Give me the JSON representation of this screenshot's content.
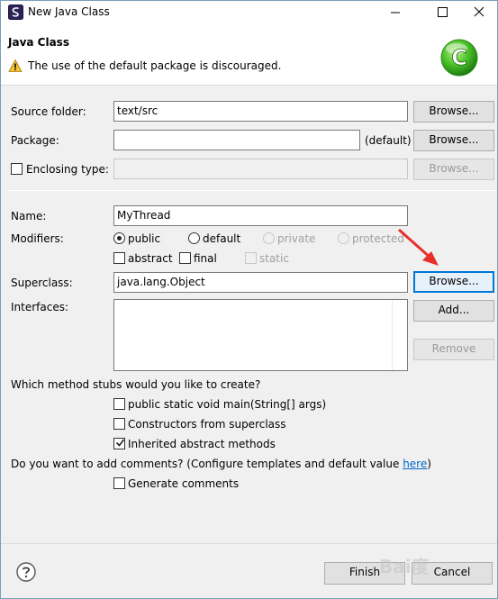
{
  "window": {
    "title": "New Java Class",
    "controls": {
      "minimize": "minimize-icon",
      "maximize": "maximize-icon",
      "close": "close-icon"
    }
  },
  "banner": {
    "title": "Java Class",
    "message": "The use of the default package is discouraged.",
    "logo_letter": "C"
  },
  "form": {
    "source_folder": {
      "label": "Source folder:",
      "value": "text/src",
      "button": "Browse..."
    },
    "package": {
      "label": "Package:",
      "value": "",
      "suffix": "(default)",
      "button": "Browse..."
    },
    "enclosing_type": {
      "label": "Enclosing type:",
      "checked": false,
      "value": "",
      "button": "Browse..."
    },
    "name": {
      "label": "Name:",
      "value": "MyThread"
    },
    "modifiers": {
      "label": "Modifiers:",
      "access": [
        {
          "label": "public",
          "selected": true,
          "enabled": true
        },
        {
          "label": "default",
          "selected": false,
          "enabled": true
        },
        {
          "label": "private",
          "selected": false,
          "enabled": false
        },
        {
          "label": "protected",
          "selected": false,
          "enabled": false
        }
      ],
      "flags": [
        {
          "label": "abstract",
          "checked": false,
          "enabled": true
        },
        {
          "label": "final",
          "checked": false,
          "enabled": true
        },
        {
          "label": "static",
          "checked": false,
          "enabled": false
        }
      ]
    },
    "superclass": {
      "label": "Superclass:",
      "value": "java.lang.Object",
      "button": "Browse..."
    },
    "interfaces": {
      "label": "Interfaces:",
      "add_button": "Add...",
      "remove_button": "Remove"
    },
    "stubs": {
      "question": "Which method stubs would you like to create?",
      "options": [
        {
          "label": "public static void main(String[] args)",
          "checked": false
        },
        {
          "label": "Constructors from superclass",
          "checked": false
        },
        {
          "label": "Inherited abstract methods",
          "checked": true
        }
      ]
    },
    "comments": {
      "question_prefix": "Do you want to add comments? (Configure templates and default value ",
      "link": "here",
      "question_suffix": ")",
      "option": {
        "label": "Generate comments",
        "checked": false
      }
    }
  },
  "footer": {
    "finish": "Finish",
    "cancel": "Cancel",
    "help_icon": "help-icon"
  },
  "watermark": "Bai度",
  "colors": {
    "accent": "#0078d7",
    "annotation_arrow": "#e8302a",
    "logo_green": "#3cb521",
    "link": "#0066cc"
  }
}
